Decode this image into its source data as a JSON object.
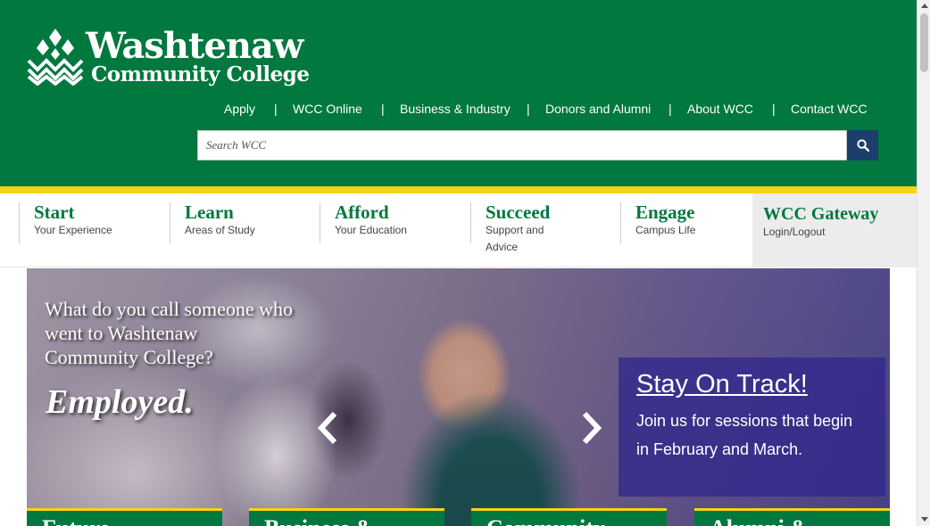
{
  "brand": {
    "name_line1": "Washtenaw",
    "name_line2": "Community College",
    "colors": {
      "green": "#00783e",
      "gold": "#f5d414",
      "navy": "#1b3f6b",
      "callout": "#32288c"
    }
  },
  "topnav": {
    "items": [
      "Apply",
      "WCC Online",
      "Business & Industry",
      "Donors and Alumni",
      "About WCC",
      "Contact WCC"
    ],
    "separator": "|"
  },
  "search": {
    "placeholder": "Search WCC",
    "value": "",
    "icon": "search-icon"
  },
  "mainnav": {
    "items": [
      {
        "title": "Start",
        "sub": "Your Experience"
      },
      {
        "title": "Learn",
        "sub": "Areas of Study"
      },
      {
        "title": "Afford",
        "sub": "Your Education"
      },
      {
        "title": "Succeed",
        "sub": "Support and Advice"
      },
      {
        "title": "Engage",
        "sub": "Campus Life"
      }
    ],
    "gateway": {
      "title": "WCC Gateway",
      "sub": "Login/Logout"
    }
  },
  "hero": {
    "question": "What do you call someone who went to Washtenaw Community College?",
    "answer": "Employed.",
    "prev_icon": "chevron-left-icon",
    "next_icon": "chevron-right-icon",
    "callout": {
      "title": "Stay On Track!",
      "body": "Join us for sessions that begin in February and March."
    },
    "tiles": [
      "Future",
      "Business &",
      "Community",
      "Alumni &"
    ]
  }
}
